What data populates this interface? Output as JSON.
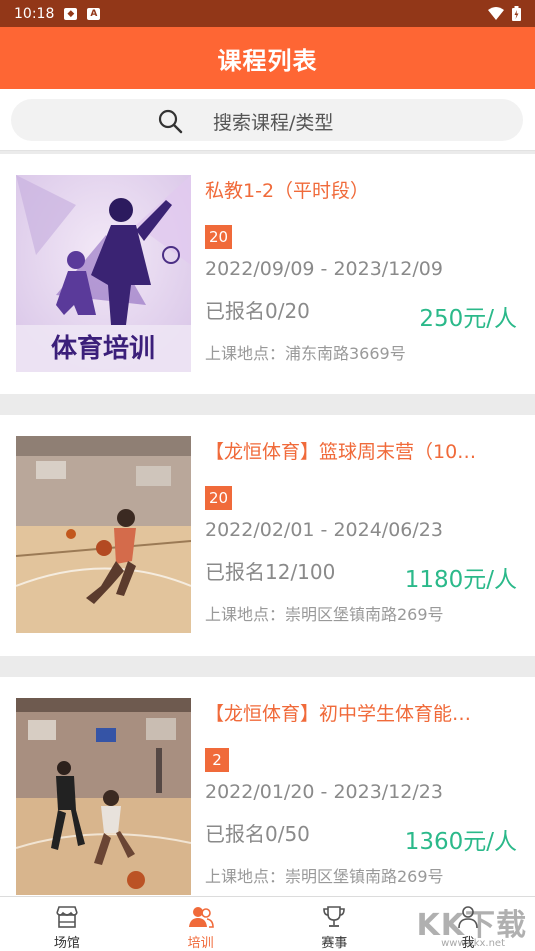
{
  "status_bar": {
    "time": "10:18"
  },
  "header": {
    "title": "课程列表"
  },
  "search": {
    "placeholder": "搜索课程/类型"
  },
  "courses": [
    {
      "title": "私教1-2（平时段）",
      "badge": "20",
      "date_range": "2022/09/09 - 2023/12/09",
      "enrolled": "已报名0/20",
      "price": "250元/人",
      "location": "上课地点：浦东南路3669号",
      "thumb_caption": "体育培训"
    },
    {
      "title": "【龙恒体育】篮球周末营（10…",
      "badge": "20",
      "date_range": "2022/02/01 - 2024/06/23",
      "enrolled": "已报名12/100",
      "price": "1180元/人",
      "location": "上课地点：崇明区堡镇南路269号"
    },
    {
      "title": "【龙恒体育】初中学生体育能…",
      "badge": "2",
      "date_range": "2022/01/20 - 2023/12/23",
      "enrolled": "已报名0/50",
      "price": "1360元/人",
      "location": "上课地点：崇明区堡镇南路269号"
    }
  ],
  "tabs": [
    {
      "label": "场馆",
      "icon": "store-icon"
    },
    {
      "label": "培训",
      "icon": "users-icon",
      "active": true
    },
    {
      "label": "赛事",
      "icon": "trophy-icon"
    },
    {
      "label": "我",
      "icon": "person-icon"
    }
  ],
  "watermark": {
    "text": "KK下载",
    "sub": "www.kkx.net"
  },
  "colors": {
    "status_bar": "#923718",
    "header": "#fe6634",
    "accent": "#f06a3a",
    "price": "#2bb98a"
  }
}
